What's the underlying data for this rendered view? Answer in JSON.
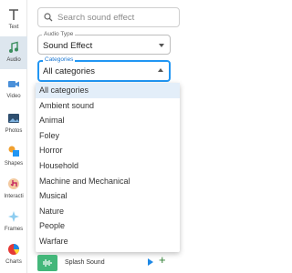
{
  "rail": {
    "items": [
      {
        "label": "Text",
        "icon": "text-icon",
        "active": false
      },
      {
        "label": "Audio",
        "icon": "music-note-icon",
        "active": true
      },
      {
        "label": "Video",
        "icon": "video-camera-icon",
        "active": false
      },
      {
        "label": "Photos",
        "icon": "photo-icon",
        "active": false
      },
      {
        "label": "Shapes",
        "icon": "shapes-icon",
        "active": false
      },
      {
        "label": "Interacti",
        "icon": "hand-pointer-icon",
        "active": false
      },
      {
        "label": "Frames",
        "icon": "sparkle-icon",
        "active": false
      },
      {
        "label": "Charts",
        "icon": "pie-chart-icon",
        "active": false
      }
    ]
  },
  "search": {
    "placeholder": "Search sound effect"
  },
  "audio_type": {
    "label": "Audio Type",
    "value": "Sound Effect"
  },
  "categories": {
    "label": "Categories",
    "value": "All categories",
    "options": [
      "All categories",
      "Ambient sound",
      "Animal",
      "Foley",
      "Horror",
      "Household",
      "Machine and Mechanical",
      "Musical",
      "Nature",
      "People",
      "Warfare"
    ],
    "selected_index": 0
  },
  "sound_item": {
    "name": "Splash Sound"
  },
  "colors": {
    "accent": "#2196f3",
    "active_rail": "#dde6ee",
    "sound_thumb": "#43b77a"
  }
}
